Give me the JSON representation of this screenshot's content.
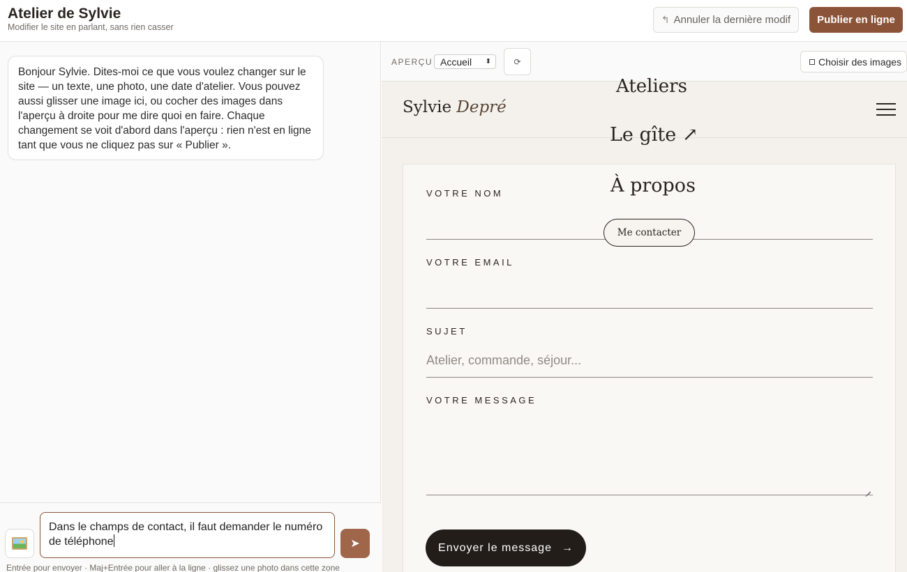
{
  "header": {
    "title": "Atelier de Sylvie",
    "subtitle": "Modifier le site en parlant, sans rien casser",
    "undo_label": "Annuler la dernière modif",
    "undo_icon": "↰",
    "publish_label": "Publier en ligne"
  },
  "chat": {
    "assistant_message": "Bonjour Sylvie. Dites-moi ce que vous voulez changer sur le site — un texte, une photo, une date d'atelier. Vous pouvez aussi glisser une image ici, ou cocher des images dans l'aperçu à droite pour me dire quoi en faire. Chaque changement se voit d'abord dans l'aperçu : rien n'est en ligne tant que vous ne cliquez pas sur « Publier ».",
    "input_value": "Dans le champs de contact, il faut demander le numéro de téléphone",
    "send_icon": "➤",
    "hint": "Entrée pour envoyer · Maj+Entrée pour aller à la ligne · glissez une photo dans cette zone"
  },
  "preview": {
    "label": "APERÇU",
    "selected_page": "Accueil",
    "refresh_icon": "⟳",
    "choose_images_label": "Choisir des images"
  },
  "site": {
    "logo_first": "Sylvie",
    "logo_last": "Depré",
    "nav_items": [
      "Ateliers",
      "Le gîte ↗",
      "À propos"
    ],
    "contact_pill": "Me contacter",
    "form": {
      "name_label": "VOTRE NOM",
      "email_label": "VOTRE EMAIL",
      "subject_label": "SUJET",
      "subject_placeholder": "Atelier, commande, séjour...",
      "message_label": "VOTRE MESSAGE",
      "submit_label": "Envoyer le message",
      "submit_arrow": "→"
    }
  }
}
